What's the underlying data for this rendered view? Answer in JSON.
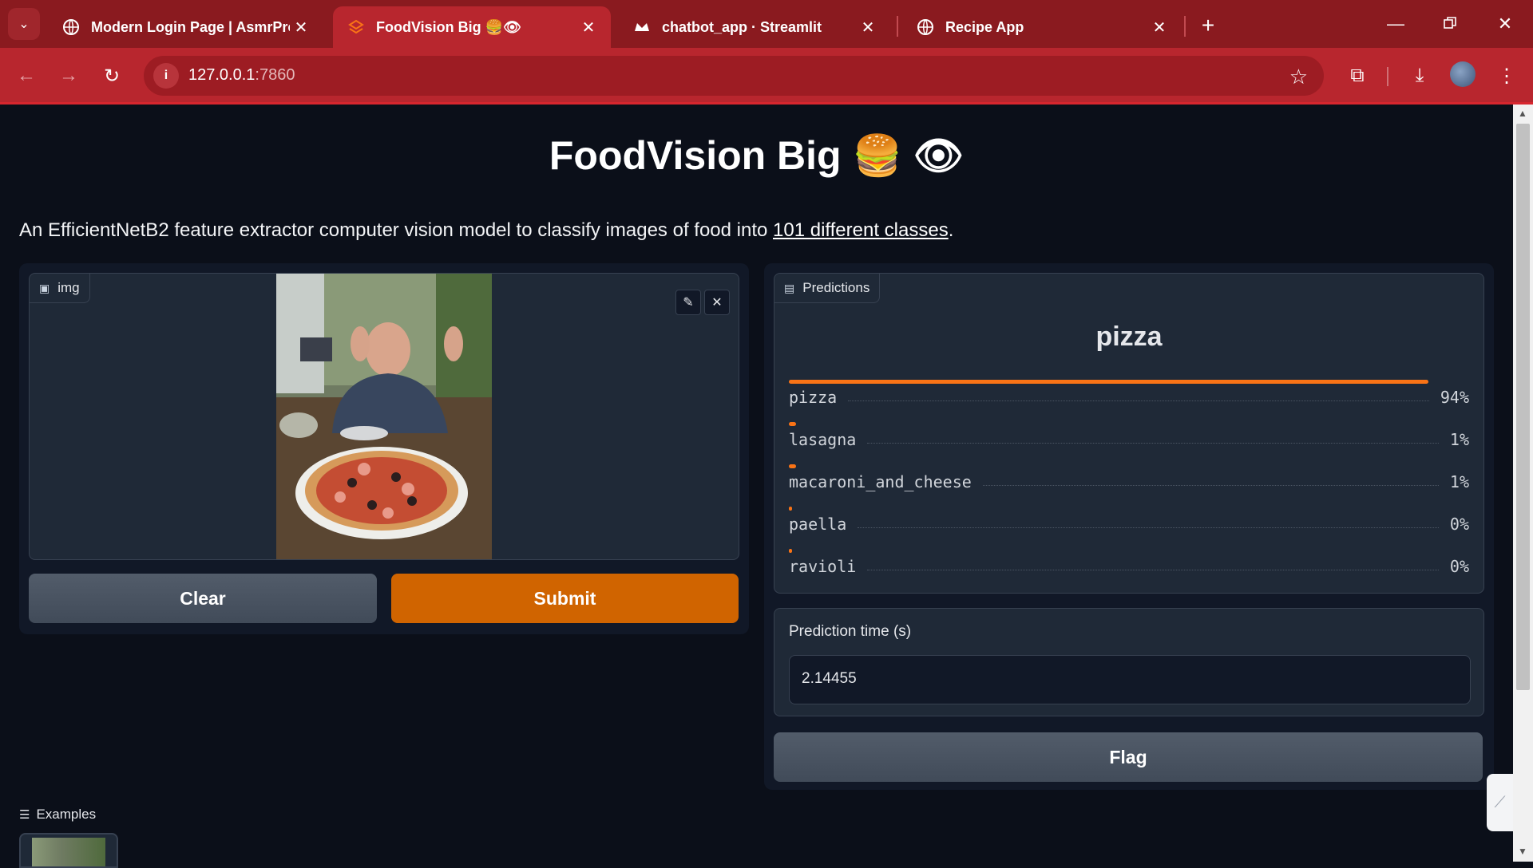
{
  "browser": {
    "tabs": [
      {
        "label": "Modern Login Page | AsmrProg"
      },
      {
        "label": "FoodVision Big 🍔👁"
      },
      {
        "label": "chatbot_app · Streamlit"
      },
      {
        "label": "Recipe App"
      }
    ],
    "url_host": "127.0.0.1",
    "url_port": ":7860"
  },
  "app": {
    "title": "FoodVision Big 🍔 👁",
    "description_prefix": "An EfficientNetB2 feature extractor computer vision model to classify images of food into ",
    "description_link": "101 different classes",
    "description_suffix": ".",
    "image_label": "img",
    "clear_label": "Clear",
    "submit_label": "Submit",
    "predictions_label": "Predictions",
    "predicted_class": "pizza",
    "predictions": [
      {
        "label": "pizza",
        "confidence": 0.94,
        "display": "94%"
      },
      {
        "label": "lasagna",
        "confidence": 0.01,
        "display": "1%"
      },
      {
        "label": "macaroni_and_cheese",
        "confidence": 0.01,
        "display": "1%"
      },
      {
        "label": "paella",
        "confidence": 0.003,
        "display": "0%"
      },
      {
        "label": "ravioli",
        "confidence": 0.002,
        "display": "0%"
      }
    ],
    "time_label": "Prediction time (s)",
    "time_value": "2.14455",
    "flag_label": "Flag",
    "examples_label": "Examples"
  },
  "colors": {
    "accent": "#d06400",
    "bar": "#f97316",
    "chrome": "#b8262e"
  }
}
